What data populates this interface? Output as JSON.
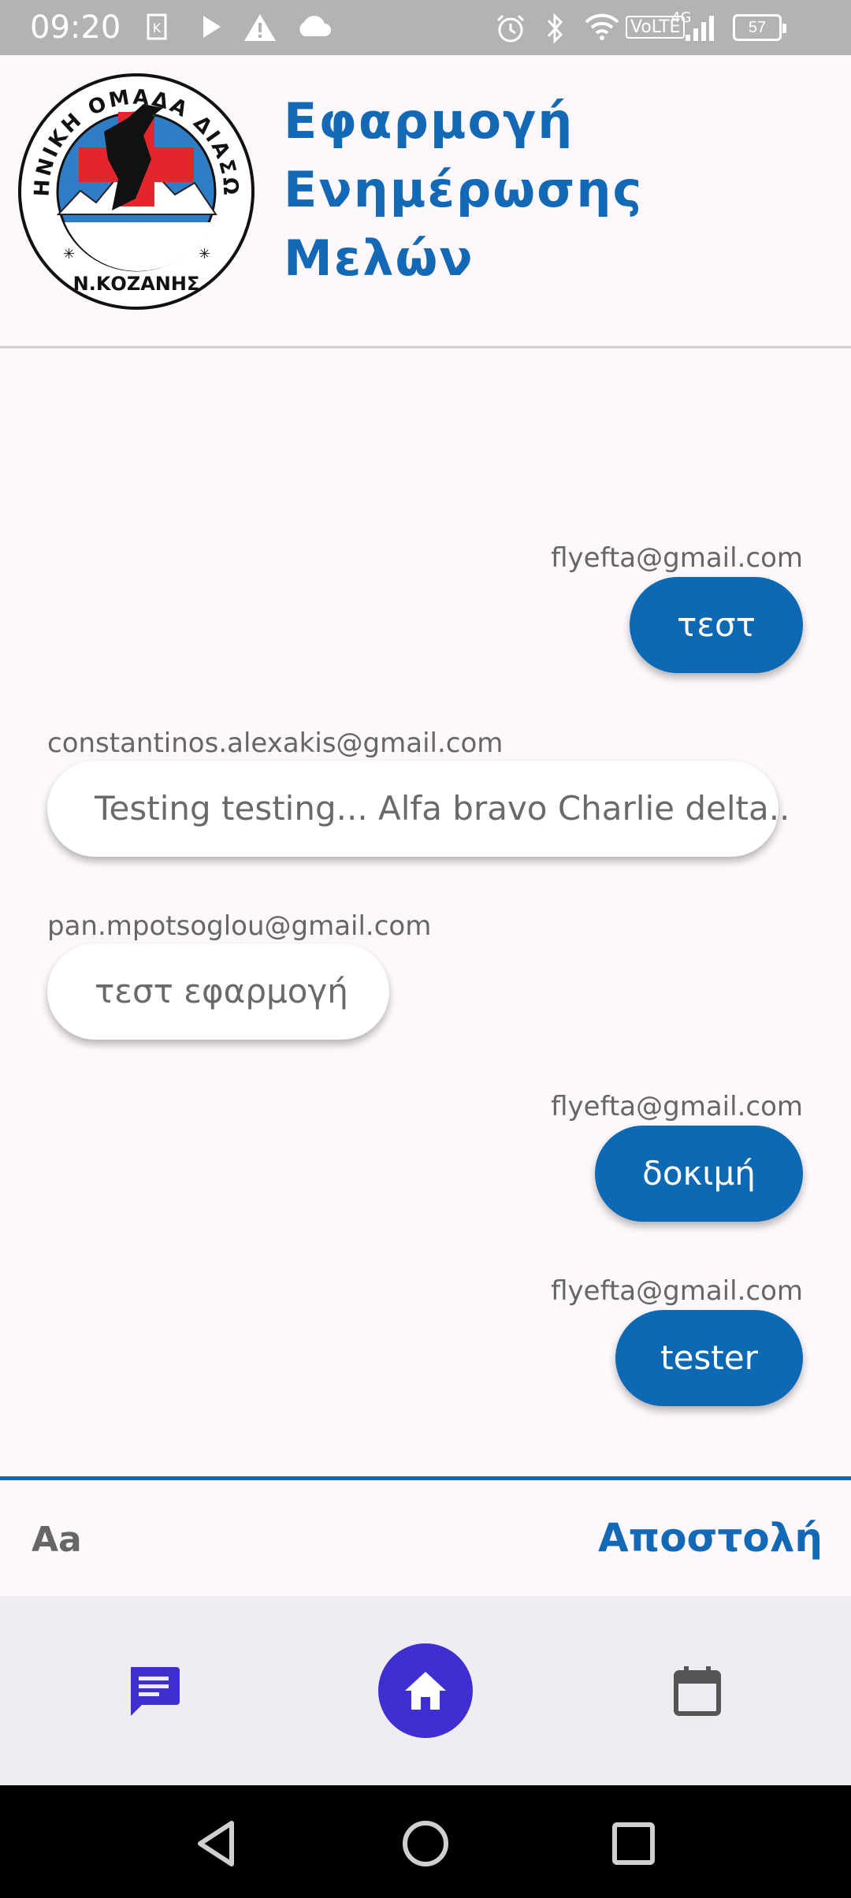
{
  "status_bar": {
    "time": "09:20",
    "network": "VoLTE",
    "signal_label": "4G",
    "battery": "57",
    "icons": [
      "app-notification-icon",
      "play-icon",
      "warning-icon",
      "cloud-icon",
      "alarm-icon",
      "bluetooth-icon",
      "wifi-icon",
      "signal-icon",
      "battery-icon"
    ]
  },
  "header": {
    "logo_text_top": "ΕΛΛΗΝΙΚΗ ΟΜΑΔΑ ΔΙΑΣΩΣΗΣ",
    "logo_text_bottom": "Ν.ΚΟΖΑΝΗΣ",
    "title_line1": "Εφαρμογή",
    "title_line2": "Ενημέρωσης",
    "title_line3": "Μελών"
  },
  "messages": [
    {
      "sender": "flyefta@gmail.com",
      "text": "τεστ",
      "mine": true
    },
    {
      "sender": "constantinos.alexakis@gmail.com",
      "text": "Testing testing... Alfa bravo Charlie delta..",
      "mine": false
    },
    {
      "sender": "pan.mpotsoglou@gmail.com",
      "text": "τεστ εφαρμογή",
      "mine": false
    },
    {
      "sender": "flyefta@gmail.com",
      "text": "δοκιμή",
      "mine": true
    },
    {
      "sender": "flyefta@gmail.com",
      "text": "tester",
      "mine": true
    }
  ],
  "composer": {
    "placeholder": "Aa",
    "send_label": "Αποστολή"
  },
  "bottom_nav": {
    "items": [
      "chat-icon",
      "home-icon",
      "calendar-icon"
    ],
    "active": "home-icon"
  },
  "colors": {
    "accent": "#1369b5",
    "bubble_mine": "#0d69b3",
    "nav_active": "#3f2fd0",
    "chat_icon": "#3f2fd0"
  }
}
